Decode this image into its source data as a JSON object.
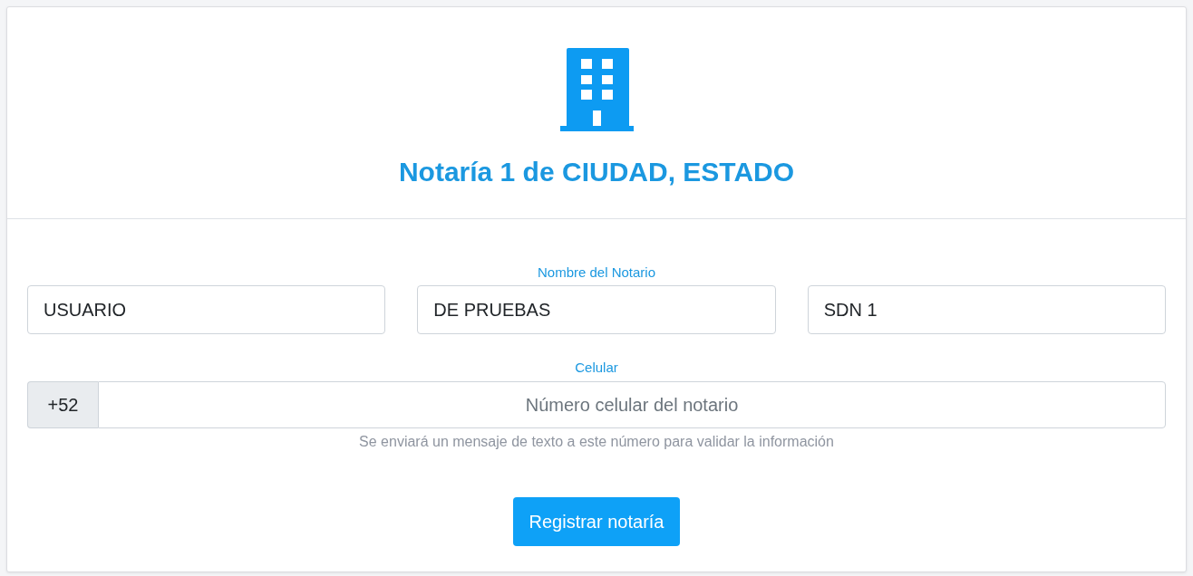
{
  "header": {
    "title": "Notaría 1 de CIUDAD, ESTADO"
  },
  "name_section": {
    "label": "Nombre del Notario",
    "fields": [
      {
        "value": "USUARIO"
      },
      {
        "value": "DE PRUEBAS"
      },
      {
        "value": "SDN 1"
      }
    ]
  },
  "phone_section": {
    "label": "Celular",
    "prefix": "+52",
    "placeholder": "Número celular del notario",
    "help": "Se enviará un mensaje de texto a este número para validar la información"
  },
  "submit_button": {
    "label": "Registrar notaría"
  }
}
